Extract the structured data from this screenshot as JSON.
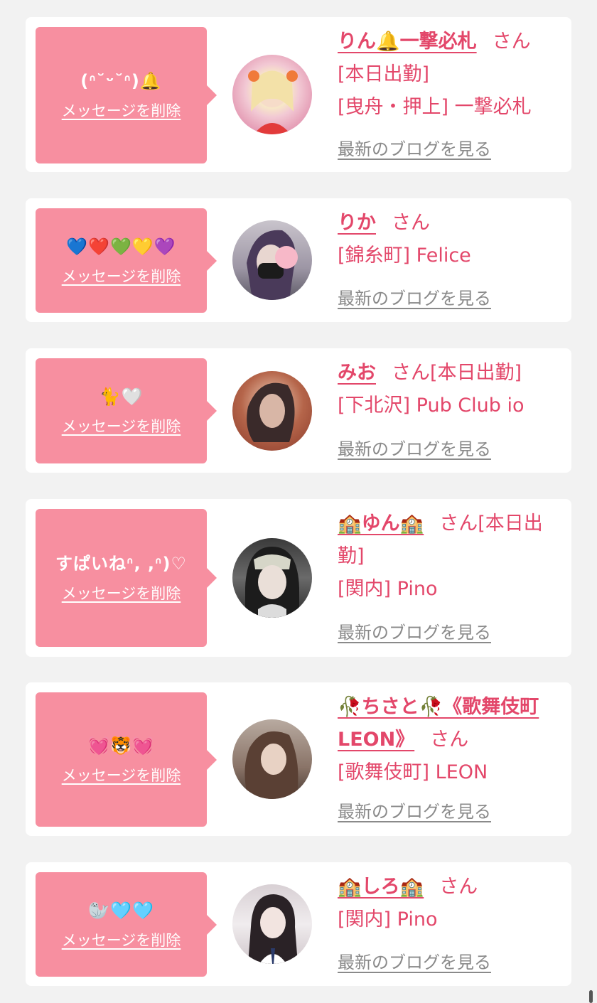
{
  "delete_label": "メッセージを削除",
  "san_label": "さん",
  "blog_label": "最新のブログを見る",
  "colors": {
    "background": "#f2f2f2",
    "card": "#ffffff",
    "bubble": "#f78fa0",
    "accent": "#e3476a",
    "link_gray": "#8a8a8a"
  },
  "messages": [
    {
      "message": "(ᐢ˘ᵕ˘ᐢ)🔔",
      "name": "りん🔔一撃必札",
      "after_san": "",
      "lines": [
        "[本日出勤]",
        "[曳舟・押上] 一撃必札"
      ]
    },
    {
      "message": "💙❤️💚💛💜",
      "name": "りか",
      "after_san": "",
      "lines": [
        "[錦糸町] Felice"
      ]
    },
    {
      "message": "🐈🤍",
      "name": "みお",
      "after_san": "[本日出勤]",
      "lines": [
        "[下北沢] Pub Club io"
      ]
    },
    {
      "message": "すぱいねᐢ, ,ᐢ)♡",
      "name": "🏫ゆん🏫",
      "after_san": "[本日出勤]",
      "lines": [
        "[関内] Pino"
      ]
    },
    {
      "message": "💓🐯💓",
      "name": "🥀ちさと🥀《歌舞伎町LEON》",
      "after_san": "",
      "lines": [
        "[歌舞伎町] LEON"
      ]
    },
    {
      "message": "🦭🩵🩵",
      "name": "🏫しろ🏫",
      "after_san": "",
      "lines": [
        "[関内] Pino"
      ]
    }
  ]
}
